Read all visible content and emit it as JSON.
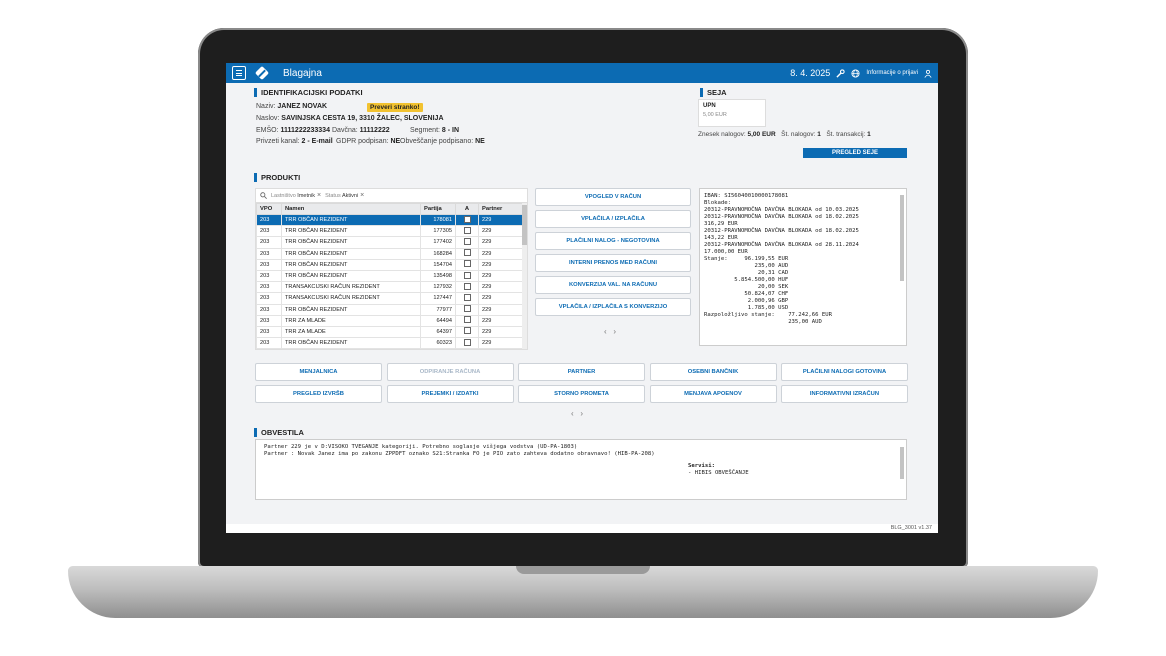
{
  "header": {
    "title": "Blagajna",
    "date": "8. 4. 2025",
    "login_info": "Informacije o prijavi"
  },
  "identification": {
    "section_title": "IDENTIFIKACIJSKI PODATKI",
    "name_label": "Naziv:",
    "name_value": "JANEZ NOVAK",
    "badge": "Preveri stranko!",
    "address_label": "Naslov:",
    "address_value": "SAVINJSKA CESTA 19, 3310 ŽALEC, SLOVENIJA",
    "emso_label": "EMŠO:",
    "emso_value": "1111222233334",
    "tax_label": "Davčna:",
    "tax_value": "11112222",
    "segment_label": "Segment:",
    "segment_value": "8 - IN",
    "channel_label": "Privzeti kanal:",
    "channel_value": "2 - E-mail",
    "gdpr_label": "GDPR podpisan:",
    "gdpr_value": "NE",
    "notify_label": "Obveščanje podpisano:",
    "notify_value": "NE"
  },
  "session": {
    "section_title": "SEJA",
    "upn_title": "UPN",
    "upn_amount": "5,00 EUR",
    "amount_label": "Znesek nalogov:",
    "amount_value": "5,00 EUR",
    "orders_label": "Št. nalogov:",
    "orders_value": "1",
    "tx_label": "Št. transakcij:",
    "tx_value": "1",
    "review_button": "PREGLED SEJE"
  },
  "products": {
    "section_title": "PRODUKTI",
    "filters": [
      {
        "key": "Lastništvo",
        "value": "Imetnik"
      },
      {
        "key": "Status",
        "value": "Aktivni"
      }
    ],
    "columns": {
      "vpo": "VPO",
      "name": "Namen",
      "partija": "Partija",
      "a": "A",
      "partner": "Partner"
    },
    "rows": [
      {
        "vpo": "203",
        "name": "TRR OBČAN REZIDENT",
        "partija": "178081",
        "partner": "229"
      },
      {
        "vpo": "203",
        "name": "TRR OBČAN REZIDENT",
        "partija": "177305",
        "partner": "229"
      },
      {
        "vpo": "203",
        "name": "TRR OBČAN REZIDENT",
        "partija": "177402",
        "partner": "229"
      },
      {
        "vpo": "203",
        "name": "TRR OBČAN REZIDENT",
        "partija": "168284",
        "partner": "229"
      },
      {
        "vpo": "203",
        "name": "TRR OBČAN REZIDENT",
        "partija": "154704",
        "partner": "229"
      },
      {
        "vpo": "203",
        "name": "TRR OBČAN REZIDENT",
        "partija": "135498",
        "partner": "229"
      },
      {
        "vpo": "203",
        "name": "TRANSAKCIJSKI RAČUN REZIDENT",
        "partija": "127932",
        "partner": "229"
      },
      {
        "vpo": "203",
        "name": "TRANSAKCIJSKI RAČUN REZIDENT",
        "partija": "127447",
        "partner": "229"
      },
      {
        "vpo": "203",
        "name": "TRR OBČAN REZIDENT",
        "partija": "77977",
        "partner": "229"
      },
      {
        "vpo": "203",
        "name": "TRR ZA MLADE",
        "partija": "64494",
        "partner": "229"
      },
      {
        "vpo": "203",
        "name": "TRR ZA MLADE",
        "partija": "64397",
        "partner": "229"
      },
      {
        "vpo": "203",
        "name": "TRR OBČAN REZIDENT",
        "partija": "60323",
        "partner": "229"
      }
    ],
    "actions": [
      "VPOGLED V RAČUN",
      "VPLAČILA / IZPLAČILA",
      "PLAČILNI NALOG - NEGOTOVINA",
      "INTERNI PRENOS MED RAČUNI",
      "KONVERZIJA VAL. NA RAČUNU",
      "VPLAČILA / IZPLAČILA S KONVERZIJO"
    ],
    "account_info": [
      "IBAN: SI56040010000178081",
      "Blokade:",
      "20312-PRAVNOMOČNA DAVČNA BLOKADA od 10.03.2025",
      "20312-PRAVNOMOČNA DAVČNA BLOKADA od 18.02.2025",
      "316,29 EUR",
      "20312-PRAVNOMOČNA DAVČNA BLOKADA od 18.02.2025",
      "143,22 EUR",
      "20312-PRAVNOMOČNA DAVČNA BLOKADA od 28.11.2024",
      "17.000,00 EUR",
      "Stanje:     96.199,55 EUR",
      "               235,00 AUD",
      "                20,31 CAD",
      "         5.854.500,00 HUF",
      "                20,00 SEK",
      "            50.824,07 CHF",
      "             2.000,96 GBP",
      "             1.785,00 USD",
      "Razpoložljivo stanje:    77.242,66 EUR",
      "                         235,00 AUD"
    ]
  },
  "buttons": [
    {
      "label": "MENJALNICA",
      "disabled": false
    },
    {
      "label": "ODPIRANJE RAČUNA",
      "disabled": true
    },
    {
      "label": "PARTNER",
      "disabled": false
    },
    {
      "label": "OSEBNI BANČNIK",
      "disabled": false
    },
    {
      "label": "PLAČILNI NALOGI GOTOVINA",
      "disabled": false
    },
    {
      "label": "PREGLED IZVRŠB",
      "disabled": false
    },
    {
      "label": "PREJEMKI / IZDATKI",
      "disabled": false
    },
    {
      "label": "STORNO PROMETA",
      "disabled": false
    },
    {
      "label": "MENJAVA APOENOV",
      "disabled": false
    },
    {
      "label": "INFORMATIVNI IZRAČUN",
      "disabled": false
    }
  ],
  "notices": {
    "section_title": "OBVESTILA",
    "line1": "Partner 229 je v D:VISOKO TVEGANJE kategoriji. Potrebno soglasje višjega vodstva (UD-PA-1803)",
    "line2": "Partner : Novak Janez ima po zakonu ZPPDFT oznako S21:Stranka FO je PIO zato zahteva dodatno obravnavo! (HIB-PA-208)",
    "services_label": "Servisi:",
    "services_item": "- HIBIS OBVEŠČANJE"
  },
  "footer": {
    "version": "BLG_3001 v1.37"
  },
  "pager": {
    "prev": "‹",
    "next": "›"
  },
  "colors": {
    "primary": "#0c6bb3",
    "badge": "#f2c230"
  }
}
